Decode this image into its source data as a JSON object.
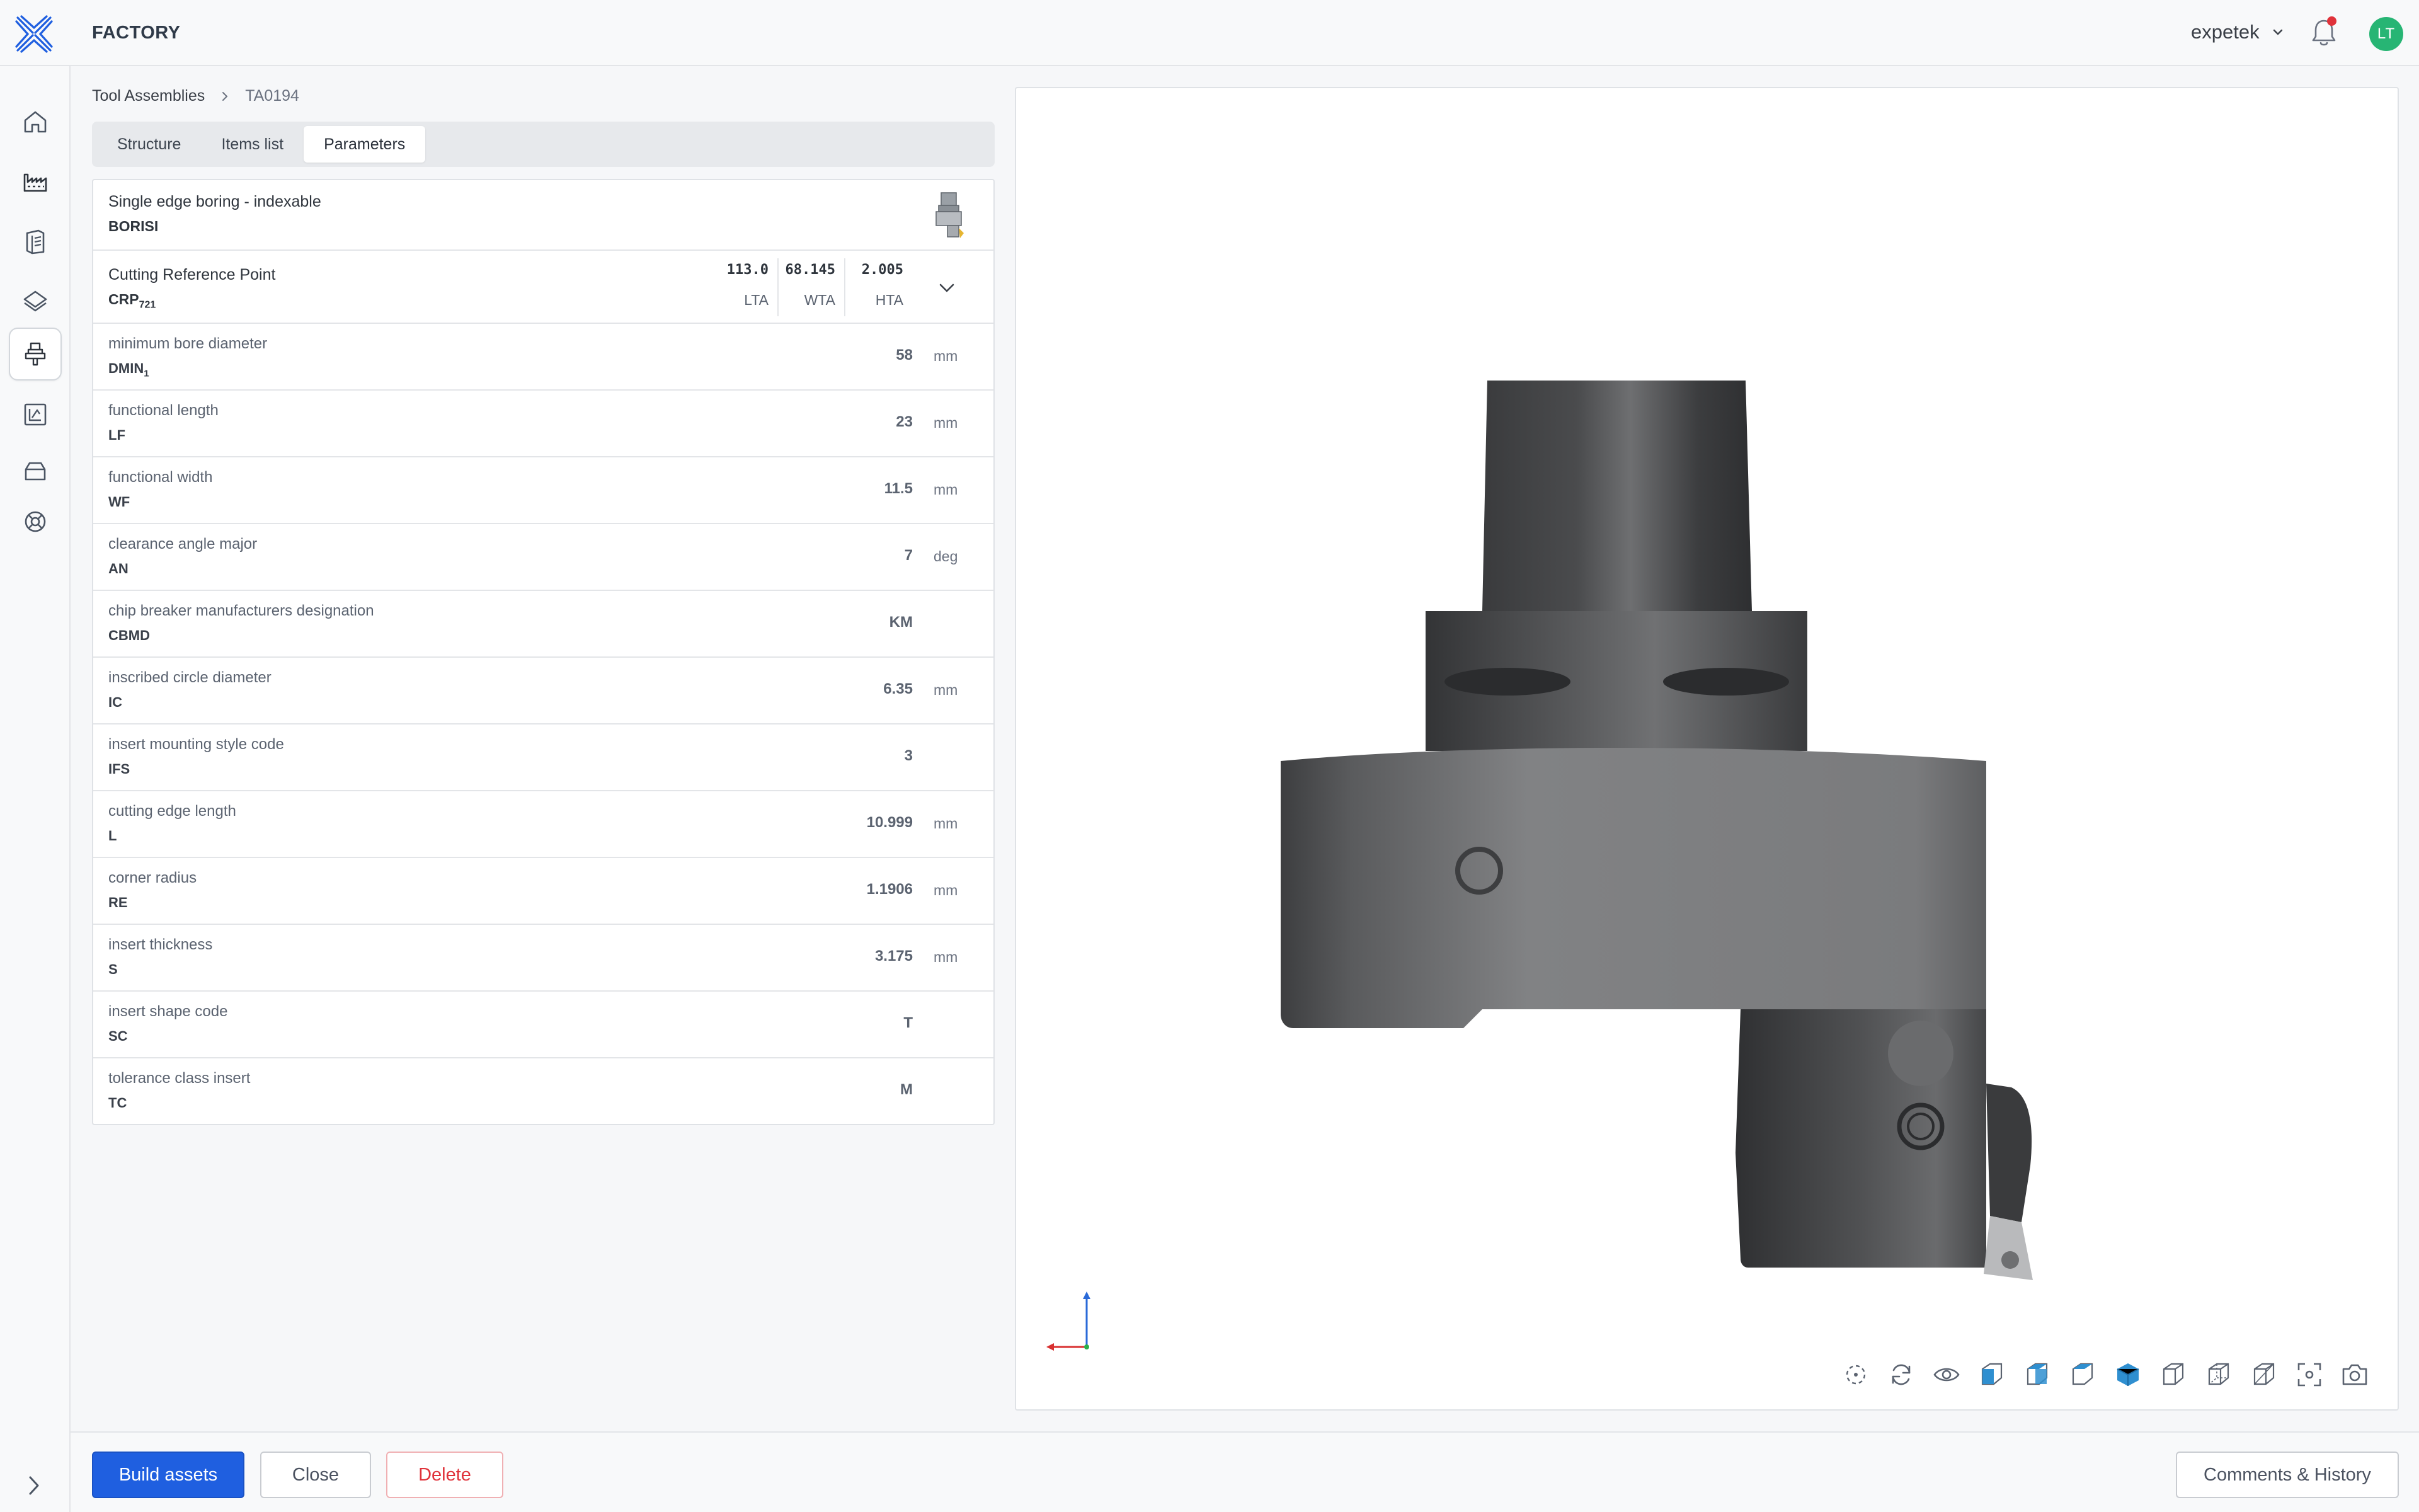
{
  "app": {
    "title": "FACTORY"
  },
  "user": {
    "name": "expetek",
    "initials": "LT"
  },
  "colors": {
    "accent": "#1f5fe0",
    "avatar": "#27b574",
    "danger": "#e0323a",
    "notification_dot": "#e0323a"
  },
  "sidebar": {
    "items": [
      {
        "icon": "home-icon",
        "active": false
      },
      {
        "icon": "factory-icon",
        "active": false
      },
      {
        "icon": "catalog-icon",
        "active": false
      },
      {
        "icon": "layers-icon",
        "active": false
      },
      {
        "icon": "tool-assembly-icon",
        "active": true
      },
      {
        "icon": "drawing-icon",
        "active": false
      },
      {
        "icon": "storage-icon",
        "active": false
      },
      {
        "icon": "support-icon",
        "active": false
      }
    ]
  },
  "breadcrumb": {
    "parent": "Tool Assemblies",
    "current": "TA0194"
  },
  "tabs": [
    {
      "label": "Structure",
      "active": false
    },
    {
      "label": "Items list",
      "active": false
    },
    {
      "label": "Parameters",
      "active": true
    }
  ],
  "header": {
    "description": "Single edge boring - indexable",
    "code": "BORISI"
  },
  "crp": {
    "description": "Cutting Reference Point",
    "code": "CRP",
    "code_sub": "721",
    "columns": [
      {
        "value": "113.0",
        "label": "LTA"
      },
      {
        "value": "68.145",
        "label": "WTA"
      },
      {
        "value": "2.005",
        "label": "HTA"
      }
    ]
  },
  "parameters": [
    {
      "description": "minimum bore diameter",
      "code": "DMIN",
      "code_sub": "1",
      "value": "58",
      "unit": "mm"
    },
    {
      "description": "functional length",
      "code": "LF",
      "code_sub": "",
      "value": "23",
      "unit": "mm"
    },
    {
      "description": "functional width",
      "code": "WF",
      "code_sub": "",
      "value": "11.5",
      "unit": "mm"
    },
    {
      "description": "clearance angle major",
      "code": "AN",
      "code_sub": "",
      "value": "7",
      "unit": "deg"
    },
    {
      "description": "chip breaker manufacturers designation",
      "code": "CBMD",
      "code_sub": "",
      "value": "KM",
      "unit": ""
    },
    {
      "description": "inscribed circle diameter",
      "code": "IC",
      "code_sub": "",
      "value": "6.35",
      "unit": "mm"
    },
    {
      "description": "insert mounting style code",
      "code": "IFS",
      "code_sub": "",
      "value": "3",
      "unit": ""
    },
    {
      "description": "cutting edge length",
      "code": "L",
      "code_sub": "",
      "value": "10.999",
      "unit": "mm"
    },
    {
      "description": "corner radius",
      "code": "RE",
      "code_sub": "",
      "value": "1.1906",
      "unit": "mm"
    },
    {
      "description": "insert thickness",
      "code": "S",
      "code_sub": "",
      "value": "3.175",
      "unit": "mm"
    },
    {
      "description": "insert shape code",
      "code": "SC",
      "code_sub": "",
      "value": "T",
      "unit": ""
    },
    {
      "description": "tolerance class insert",
      "code": "TC",
      "code_sub": "",
      "value": "M",
      "unit": ""
    }
  ],
  "viewer_tools": [
    "fit-selection-icon",
    "rotate-icon",
    "visibility-icon",
    "view-front-icon",
    "view-top-icon",
    "view-side-icon",
    "view-iso-icon",
    "wireframe-front-icon",
    "wireframe-side-icon",
    "wireframe-top-icon",
    "focus-icon",
    "screenshot-icon"
  ],
  "footer": {
    "build_label": "Build assets",
    "close_label": "Close",
    "delete_label": "Delete",
    "comments_label": "Comments & History"
  }
}
